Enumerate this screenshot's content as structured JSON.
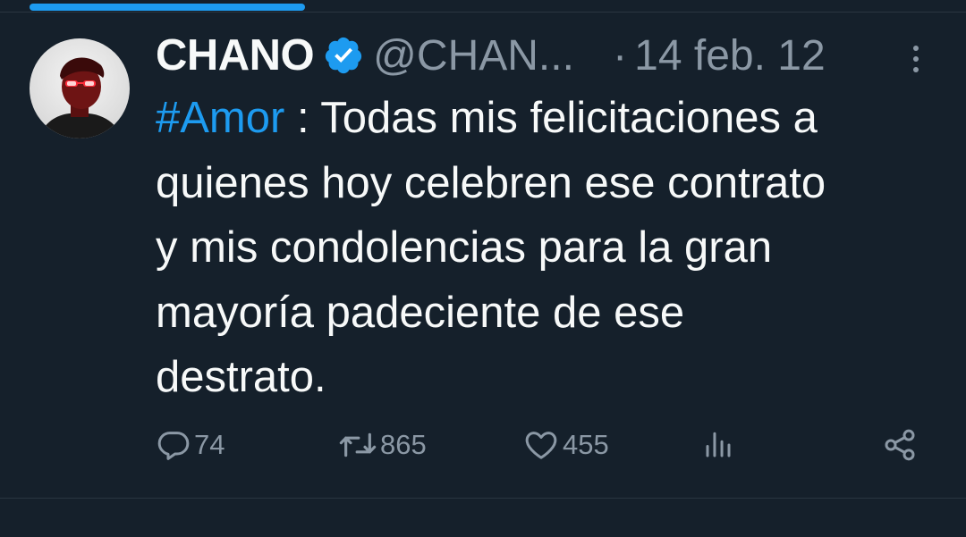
{
  "tweet": {
    "author_name": "CHANO",
    "handle": "@CHAN...",
    "separator": "·",
    "date": "14 feb. 12",
    "hashtag": "#Amor",
    "body_line1_rest": " : Todas mis felicitaciones a",
    "body_line2": "quienes hoy celebren ese contrato",
    "body_line3": "y mis condolencias para la gran",
    "body_line4": "mayoría padeciente de ese",
    "body_line5": "destrato."
  },
  "actions": {
    "replies": "74",
    "retweets": "865",
    "likes": "455"
  },
  "icons": {
    "verified": "verified-badge-icon",
    "more": "more-vertical-icon",
    "reply": "reply-icon",
    "retweet": "retweet-icon",
    "like": "heart-icon",
    "views": "analytics-icon",
    "share": "share-icon"
  },
  "colors": {
    "background": "#15202b",
    "accent": "#1d9bf0",
    "text": "#f7f9f9",
    "secondary_text": "#8b98a5"
  }
}
